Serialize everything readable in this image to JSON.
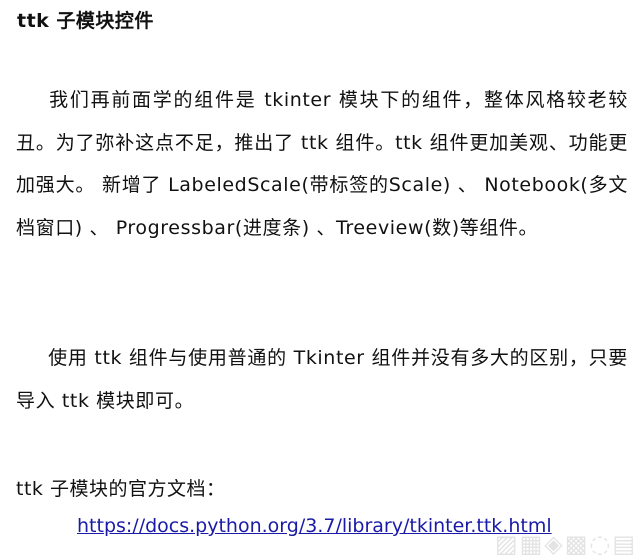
{
  "document": {
    "title": "ttk 子模块控件",
    "paragraph1": "我们再前面学的组件是 tkinter 模块下的组件，整体风格较老较丑。为了弥补这点不足，推出了 ttk 组件。ttk 组件更加美观、功能更加强大。 新增了 LabeledScale(带标签的Scale) 、 Notebook(多文档窗口) 、 Progressbar(进度条) 、Treeview(数)等组件。",
    "paragraph2": "使用 ttk 组件与使用普通的 Tkinter 组件并没有多大的区别，只要导入 ttk 模块即可。",
    "doc_label": "ttk 子模块的官方文档：",
    "doc_link": "https://docs.python.org/3.7/library/tkinter.ttk.html"
  }
}
